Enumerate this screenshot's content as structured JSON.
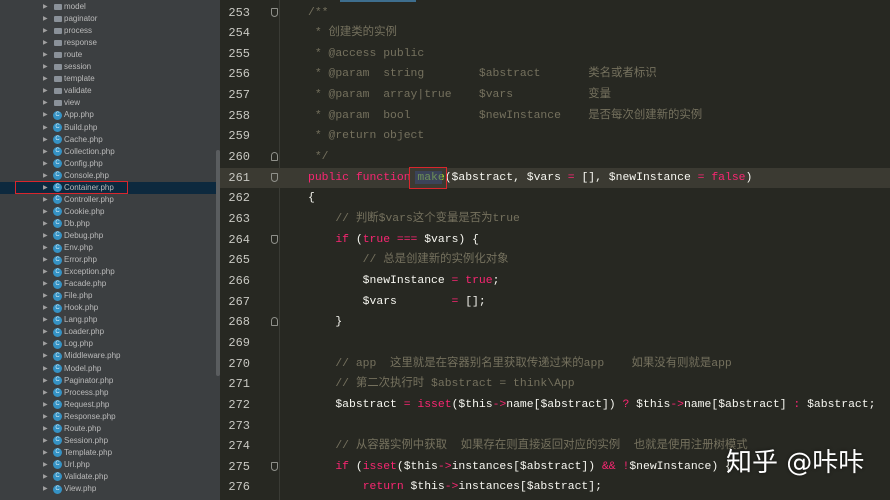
{
  "sidebar": {
    "items": [
      {
        "label": "model",
        "type": "folder"
      },
      {
        "label": "paginator",
        "type": "folder"
      },
      {
        "label": "process",
        "type": "folder"
      },
      {
        "label": "response",
        "type": "folder"
      },
      {
        "label": "route",
        "type": "folder"
      },
      {
        "label": "session",
        "type": "folder"
      },
      {
        "label": "template",
        "type": "folder"
      },
      {
        "label": "validate",
        "type": "folder"
      },
      {
        "label": "view",
        "type": "folder"
      },
      {
        "label": "App.php",
        "type": "class"
      },
      {
        "label": "Build.php",
        "type": "class"
      },
      {
        "label": "Cache.php",
        "type": "class"
      },
      {
        "label": "Collection.php",
        "type": "class"
      },
      {
        "label": "Config.php",
        "type": "class"
      },
      {
        "label": "Console.php",
        "type": "class"
      },
      {
        "label": "Container.php",
        "type": "class",
        "selected": true
      },
      {
        "label": "Controller.php",
        "type": "class"
      },
      {
        "label": "Cookie.php",
        "type": "class"
      },
      {
        "label": "Db.php",
        "type": "class"
      },
      {
        "label": "Debug.php",
        "type": "class"
      },
      {
        "label": "Env.php",
        "type": "class"
      },
      {
        "label": "Error.php",
        "type": "class"
      },
      {
        "label": "Exception.php",
        "type": "class"
      },
      {
        "label": "Facade.php",
        "type": "class"
      },
      {
        "label": "File.php",
        "type": "class"
      },
      {
        "label": "Hook.php",
        "type": "class"
      },
      {
        "label": "Lang.php",
        "type": "class"
      },
      {
        "label": "Loader.php",
        "type": "class"
      },
      {
        "label": "Log.php",
        "type": "class"
      },
      {
        "label": "Middleware.php",
        "type": "class"
      },
      {
        "label": "Model.php",
        "type": "class"
      },
      {
        "label": "Paginator.php",
        "type": "class"
      },
      {
        "label": "Process.php",
        "type": "class"
      },
      {
        "label": "Request.php",
        "type": "class"
      },
      {
        "label": "Response.php",
        "type": "class"
      },
      {
        "label": "Route.php",
        "type": "class"
      },
      {
        "label": "Session.php",
        "type": "class"
      },
      {
        "label": "Template.php",
        "type": "class"
      },
      {
        "label": "Url.php",
        "type": "class"
      },
      {
        "label": "Validate.php",
        "type": "class"
      },
      {
        "label": "View.php",
        "type": "class"
      }
    ],
    "icons": {
      "expand": "triangle-right-icon",
      "folder": "folder-icon",
      "class": "php-class-icon"
    },
    "class_icon_letter": "C"
  },
  "editor": {
    "lines": [
      {
        "n": "253",
        "fold": "down",
        "tokens": [
          [
            "/**",
            "c"
          ]
        ]
      },
      {
        "n": "254",
        "tokens": [
          [
            " * 创建类的实例",
            "c"
          ]
        ]
      },
      {
        "n": "255",
        "tokens": [
          [
            " * @access public",
            "c"
          ]
        ]
      },
      {
        "n": "256",
        "tokens": [
          [
            " * @param  string        $abstract       类名或者标识",
            "c"
          ]
        ]
      },
      {
        "n": "257",
        "tokens": [
          [
            " * @param  array|true    $vars           变量",
            "c"
          ]
        ]
      },
      {
        "n": "258",
        "tokens": [
          [
            " * @param  bool          $newInstance    是否每次创建新的实例",
            "c"
          ]
        ]
      },
      {
        "n": "259",
        "tokens": [
          [
            " * @return object",
            "c"
          ]
        ]
      },
      {
        "n": "260",
        "fold": "up",
        "tokens": [
          [
            " */",
            "c"
          ]
        ]
      },
      {
        "n": "261",
        "fold": "down",
        "current": true,
        "tokens": [
          [
            "public function ",
            "k"
          ],
          [
            "make",
            "f"
          ],
          [
            "($abstract, $vars ",
            "v"
          ],
          [
            "=",
            "o"
          ],
          [
            " [], $newInstance ",
            "v"
          ],
          [
            "=",
            "o"
          ],
          [
            " ",
            "v"
          ],
          [
            "false",
            "k"
          ],
          [
            ")",
            "v"
          ]
        ]
      },
      {
        "n": "262",
        "tokens": [
          [
            "{",
            "v"
          ]
        ]
      },
      {
        "n": "263",
        "tokens": [
          [
            "    // 判断$vars这个变量是否为true",
            "c"
          ]
        ]
      },
      {
        "n": "264",
        "fold": "down",
        "tokens": [
          [
            "    ",
            "v"
          ],
          [
            "if",
            "k"
          ],
          [
            " (",
            "v"
          ],
          [
            "true",
            "k"
          ],
          [
            " ",
            "v"
          ],
          [
            "===",
            "o"
          ],
          [
            " $vars) {",
            "v"
          ]
        ]
      },
      {
        "n": "265",
        "tokens": [
          [
            "        // 总是创建新的实例化对象",
            "c"
          ]
        ]
      },
      {
        "n": "266",
        "tokens": [
          [
            "        $newInstance ",
            "v"
          ],
          [
            "=",
            "o"
          ],
          [
            " ",
            "v"
          ],
          [
            "true",
            "k"
          ],
          [
            ";",
            "v"
          ]
        ]
      },
      {
        "n": "267",
        "tokens": [
          [
            "        $vars        ",
            "v"
          ],
          [
            "=",
            "o"
          ],
          [
            " [];",
            "v"
          ]
        ]
      },
      {
        "n": "268",
        "fold": "up",
        "tokens": [
          [
            "    }",
            "v"
          ]
        ]
      },
      {
        "n": "269",
        "tokens": []
      },
      {
        "n": "270",
        "tokens": [
          [
            "    // app  这里就是在容器别名里获取传递过来的app    如果没有则就是app",
            "c"
          ]
        ]
      },
      {
        "n": "271",
        "tokens": [
          [
            "    // 第二次执行时 $abstract = think\\App",
            "c"
          ]
        ]
      },
      {
        "n": "272",
        "tokens": [
          [
            "    $abstract ",
            "v"
          ],
          [
            "=",
            "o"
          ],
          [
            " ",
            "v"
          ],
          [
            "isset",
            "k"
          ],
          [
            "($this",
            "v"
          ],
          [
            "->",
            "o"
          ],
          [
            "name[$abstract]) ",
            "v"
          ],
          [
            "?",
            "o"
          ],
          [
            " $this",
            "v"
          ],
          [
            "->",
            "o"
          ],
          [
            "name[$abstract] ",
            "v"
          ],
          [
            ":",
            "o"
          ],
          [
            " $abstract;",
            "v"
          ]
        ]
      },
      {
        "n": "273",
        "tokens": []
      },
      {
        "n": "274",
        "tokens": [
          [
            "    // 从容器实例中获取  如果存在则直接返回对应的实例  也就是使用注册树模式",
            "c"
          ]
        ]
      },
      {
        "n": "275",
        "fold": "down",
        "tokens": [
          [
            "    ",
            "v"
          ],
          [
            "if",
            "k"
          ],
          [
            " (",
            "v"
          ],
          [
            "isset",
            "k"
          ],
          [
            "($this",
            "v"
          ],
          [
            "->",
            "o"
          ],
          [
            "instances[$abstract]) ",
            "v"
          ],
          [
            "&&",
            "o"
          ],
          [
            " ",
            "v"
          ],
          [
            "!",
            "o"
          ],
          [
            "$newInstance) {",
            "v"
          ]
        ]
      },
      {
        "n": "276",
        "tokens": [
          [
            "        ",
            "v"
          ],
          [
            "return",
            "k"
          ],
          [
            " $this",
            "v"
          ],
          [
            "->",
            "o"
          ],
          [
            "instances[$abstract];",
            "v"
          ]
        ]
      }
    ]
  },
  "watermark": "知乎 @咔咔",
  "colors": {
    "sidebar_bg": "#3c3f41",
    "editor_bg": "#272822",
    "comment": "#75715e",
    "keyword": "#f92672",
    "function": "#a6e22e",
    "highlight_box": "#d9262c"
  }
}
